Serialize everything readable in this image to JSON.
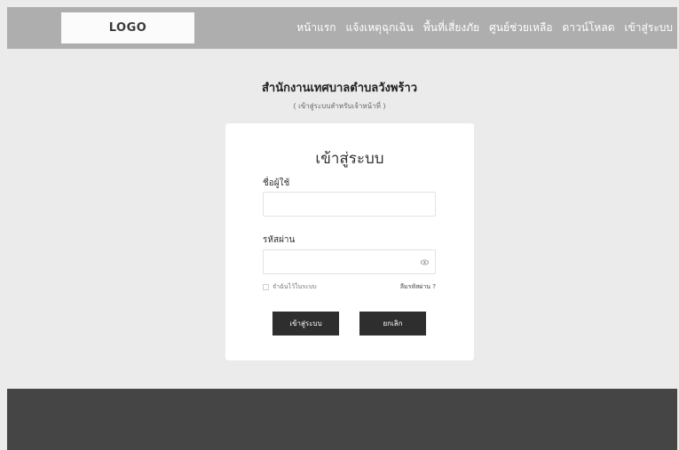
{
  "header": {
    "logo_text": "LOGO",
    "nav": [
      "หน้าแรก",
      "แจ้งเหตุฉุกเฉิน",
      "พื้นที่เสี่ยงภัย",
      "ศูนย์ช่วยเหลือ",
      "ดาวน์โหลด",
      "เข้าสู่ระบบ"
    ]
  },
  "page": {
    "org_title": "สำนักงานเทศบาลตำบลวังพร้าว",
    "org_subtitle": "( เข้าสู่ระบบสำหรับเจ้าหน้าที่ )"
  },
  "login": {
    "title": "เข้าสู่ระบบ",
    "username_label": "ชื่อผู้ใช้",
    "username_value": "",
    "password_label": "รหัสผ่าน",
    "password_value": "",
    "remember_label": "จำฉันไว้ในระบบ",
    "forgot_label": "ลืมรหัสผ่าน ?",
    "submit_label": "เข้าสู่ระบบ",
    "cancel_label": "ยกเลิก",
    "password_toggle_icon": "eye-icon"
  },
  "colors": {
    "header_bg": "#aeaeae",
    "page_bg": "#ebebeb",
    "button_bg": "#2e2e2e",
    "footer_bg": "#454545"
  }
}
